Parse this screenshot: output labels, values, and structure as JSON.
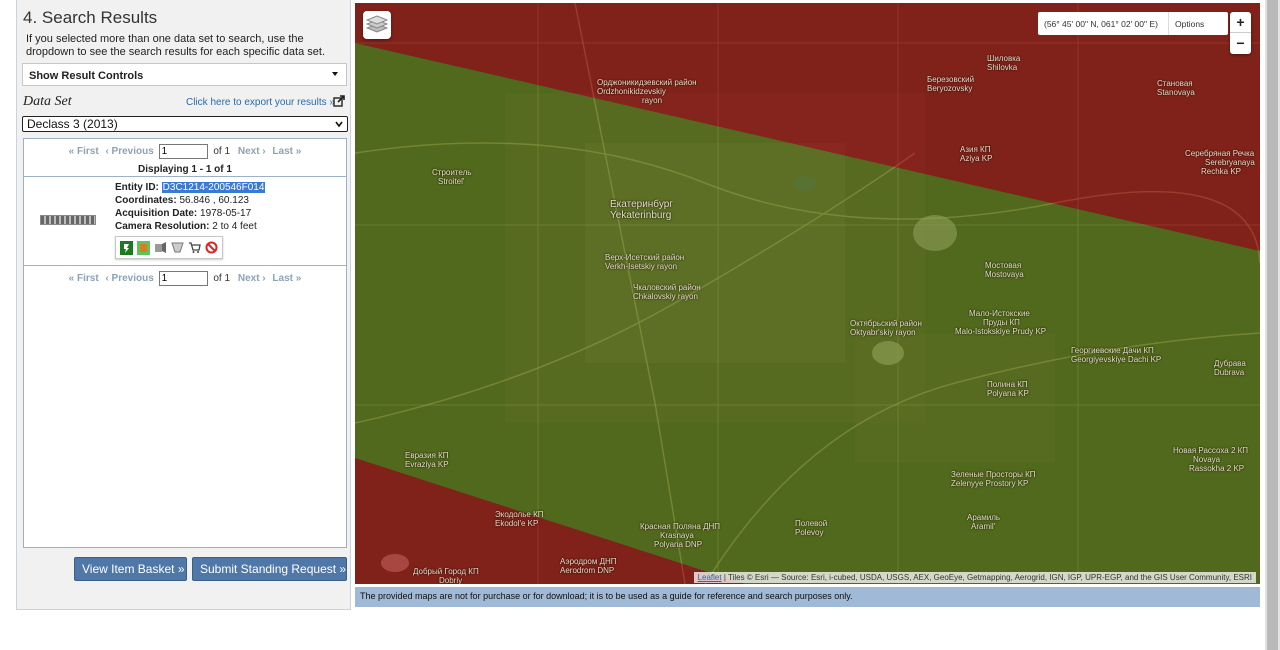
{
  "panel": {
    "title": "4. Search Results",
    "description": "If you selected more than one data set to search, use the dropdown to see the search results for each specific data set.",
    "result_controls_label": "Show Result Controls",
    "dataset_label": "Data Set",
    "export_link": "Click here to export your results »",
    "dataset_selected": "Declass 3 (2013)"
  },
  "pager": {
    "first": "« First",
    "previous": "‹ Previous",
    "page_value": "1",
    "of_label": "of 1",
    "next": "Next ›",
    "last": "Last »",
    "displaying": "Displaying 1 - 1 of 1"
  },
  "result": {
    "entity_label": "Entity ID:",
    "entity_id": "D3C1214-200546F014",
    "coords_label": "Coordinates:",
    "coords_value": "56.846 , 60.123",
    "date_label": "Acquisition Date:",
    "date_value": "1978-05-17",
    "res_label": "Camera Resolution:",
    "res_value": "2 to 4 feet",
    "action_icons": [
      "footprint-icon",
      "overlay-icon",
      "metadata-icon",
      "download-icon",
      "cart-icon",
      "exclude-icon"
    ]
  },
  "buttons": {
    "basket": "View Item Basket »",
    "standing": "Submit Standing Request »"
  },
  "map": {
    "coord_readout": "(56° 45' 00\" N, 061° 02' 00\" E)",
    "options": "Options",
    "zoom_in": "+",
    "zoom_out": "−",
    "attribution_link": "Leaflet",
    "attribution_text": " | Tiles © Esri — Source: Esri, i-cubed, USDA, USGS, AEX, GeoEye, Getmapping, Aerogrid, IGN, IGP, UPR-EGP, and the GIS User Community, ESRI",
    "labels": {
      "ekb_ru": "Екатеринбург",
      "ekb_en": "Yekaterinburg",
      "ordz_ru": "Орджоникидзевский район",
      "ordz_en": "Ordzhonikidzevskiy",
      "ordz_en2": "rayon",
      "ver_ru": "Верх-Исетский район",
      "ver_en": "Verkh-Isetskiy rayon",
      "chk_ru": "Чкаловский район",
      "chk_en": "Chkalovskiy rayon",
      "okt_ru": "Октябрьский район",
      "okt_en": "Oktyabr'skiy rayon",
      "ber_ru": "Березовский",
      "ber_en": "Beryozovsky",
      "shil_ru": "Шиловка",
      "shil_en": "Shilovka",
      "stan_ru": "Становая",
      "stan_en": "Stanovaya",
      "aziya_ru": "Азия КП",
      "aziya_en": "Aziya KP",
      "serr_ru": "Серебряная Речка",
      "serr_en": "Serebryanaya",
      "serr_en2": "Rechka KP",
      "most_ru": "Мостовая",
      "most_en": "Mostovaya",
      "malo_ru": "Мало-Истокские",
      "malo_ru2": "Пруды КП",
      "malo_en": "Malo-Istokskiye Prudy KP",
      "geo_ru": "Георгиевские Дачи КП",
      "geo_en": "Georgiyevskiye Dachi KP",
      "pol_ru": "Полина КП",
      "pol_en": "Polyana KP",
      "dub_ru": "Дубрава",
      "dub_en": "Dubrava",
      "nov_ru": "Новая Рассоха 2 КП",
      "nov_en": "Novaya",
      "nov_en2": "Rassokha 2 KP",
      "str_ru": "Строитель",
      "str_en": "Stroitel'",
      "evr_ru": "Евразия КП",
      "evr_en": "Evraziya KP",
      "ekod_ru": "Экодолье КП",
      "ekod_en": "Ekodol'e KP",
      "kras_ru": "Красная Поляна ДНП",
      "kras_en": "Krasnaya",
      "kras_en2": "Polyana DNP",
      "aer_ru": "Аэродром ДНП",
      "aer_en": "Aerodrom DNP",
      "dob_ru": "Добрый Город КП",
      "dob_en": "Dobriy",
      "zel_ru": "Зеленые Просторы КП",
      "zel_en": "Zelenyye Prostory KP",
      "aram_ru": "Арамиль",
      "aram_en": "Aramil'",
      "polev_ru": "Полевой",
      "polev_en": "Polevoy"
    }
  },
  "disclaimer": "The provided maps are not for purchase or for download; it is to be used as a guide for reference and search purposes only."
}
